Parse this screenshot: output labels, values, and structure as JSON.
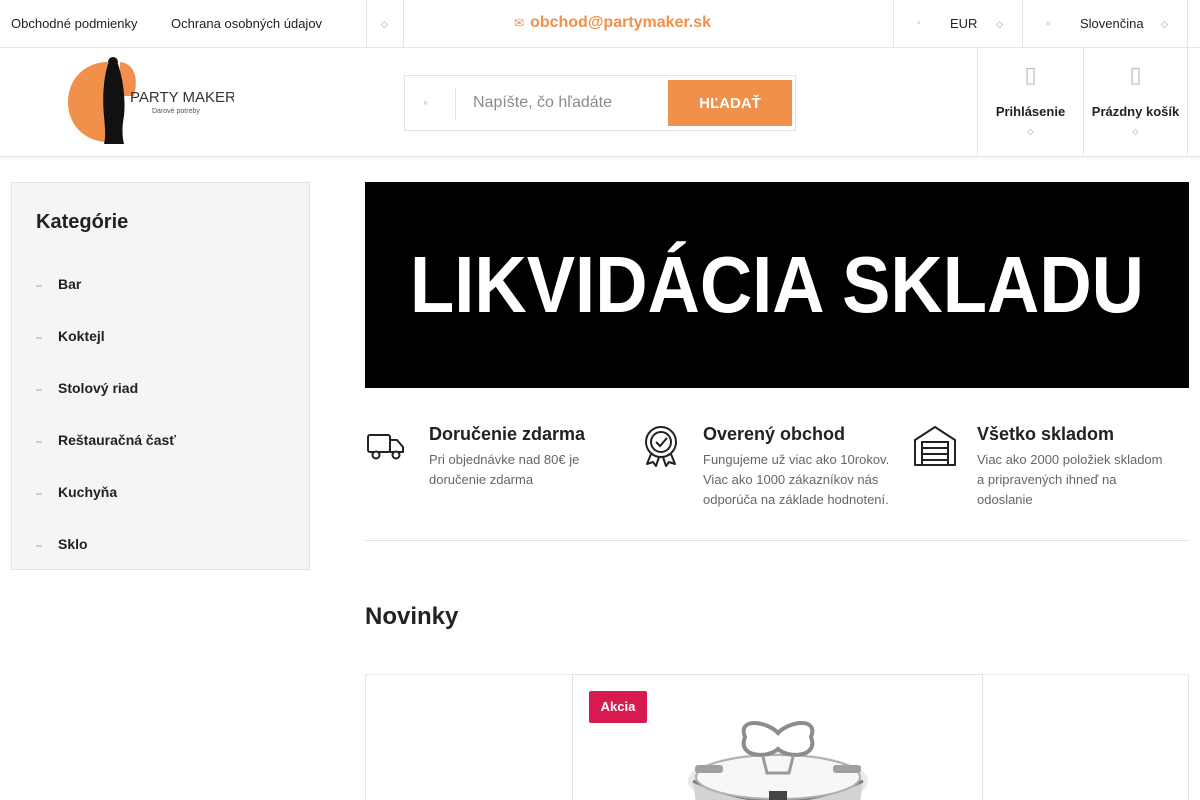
{
  "topbar": {
    "links": [
      "Obchodné podmienky",
      "Ochrana osobných údajov"
    ],
    "email": "obchod@partymaker.sk",
    "currency": "EUR",
    "language": "Slovenčina"
  },
  "header": {
    "logo": {
      "brand": "PARTY MAKER",
      "tagline": "Darové potreby"
    },
    "search": {
      "placeholder": "Napíšte, čo hľadáte",
      "button": "HĽADAŤ"
    },
    "account_label": "Prihlásenie",
    "cart_label": "Prázdny košík"
  },
  "sidebar": {
    "title": "Kategórie",
    "categories": [
      "Bar",
      "Koktejl",
      "Stolový riad",
      "Reštauračná časť",
      "Kuchyňa",
      "Sklo"
    ]
  },
  "banner": {
    "text": "LIKVIDÁCIA SKLADU"
  },
  "features": [
    {
      "icon": "truck-icon",
      "title": "Doručenie zdarma",
      "text": "Pri objednávke nad 80€ je doručenie zdarma"
    },
    {
      "icon": "award-badge-icon",
      "title": "Overený obchod",
      "text": "Fungujeme už viac ako 10rokov. Viac ako 1000 zákazníkov nás odporúča na základe hodnotení."
    },
    {
      "icon": "warehouse-icon",
      "title": "Všetko skladom",
      "text": "Viac ako 2000 položiek skladom a pripravených ihneď na odoslanie"
    }
  ],
  "novinky": {
    "title": "Novinky",
    "product_badge": "Akcia"
  },
  "colors": {
    "accent": "#f0904a",
    "badge": "#d81b4f",
    "sidebar_bg": "#f5f5f5",
    "banner_bg": "#000000"
  }
}
